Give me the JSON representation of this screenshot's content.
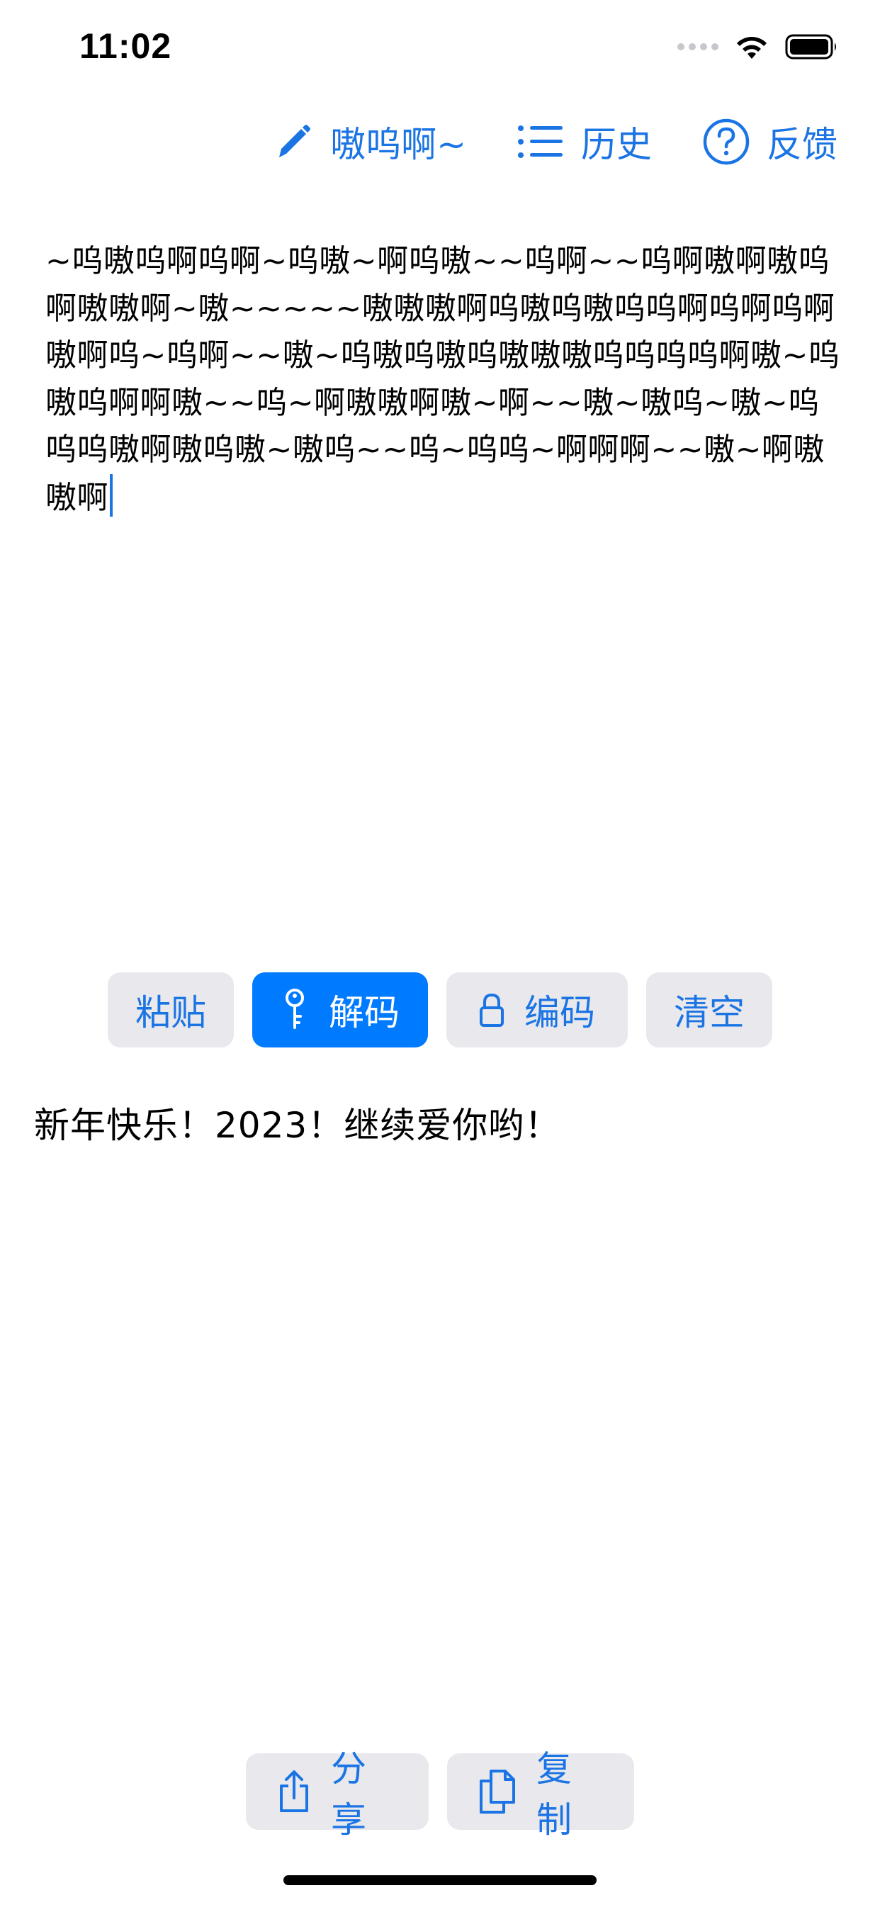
{
  "status_bar": {
    "time": "11:02"
  },
  "nav": {
    "mode_label": "嗷呜啊~",
    "history_label": "历史",
    "feedback_label": "反馈"
  },
  "input": {
    "text": "~呜嗷呜啊呜啊~呜嗷~啊呜嗷~~呜啊~~呜啊嗷啊嗷呜啊嗷嗷啊~嗷~~~~~嗷嗷嗷啊呜嗷呜嗷呜呜啊呜啊呜啊嗷啊呜~呜啊~~嗷~呜嗷呜嗷呜嗷嗷嗷呜呜呜呜啊嗷~呜嗷呜啊啊嗷~~呜~啊嗷嗷啊嗷~啊~~嗷~嗷呜~嗷~呜呜呜嗷啊嗷呜嗷~嗷呜~~呜~呜呜~啊啊啊~~嗷~啊嗷嗷啊"
  },
  "actions": {
    "paste_label": "粘贴",
    "decode_label": "解码",
    "encode_label": "编码",
    "clear_label": "清空"
  },
  "output": {
    "text": "新年快乐！2023！继续爱你哟！"
  },
  "bottom": {
    "share_label": "分享",
    "copy_label": "复制"
  },
  "colors": {
    "accent": "#007aff",
    "link_blue": "#1b74e4",
    "button_gray": "#e8e8ed"
  },
  "icons": {
    "mode": "pencil-icon",
    "history": "list-icon",
    "feedback": "question-circle-icon",
    "decode": "key-icon",
    "encode": "lock-icon",
    "share": "share-icon",
    "copy": "copy-docs-icon"
  }
}
